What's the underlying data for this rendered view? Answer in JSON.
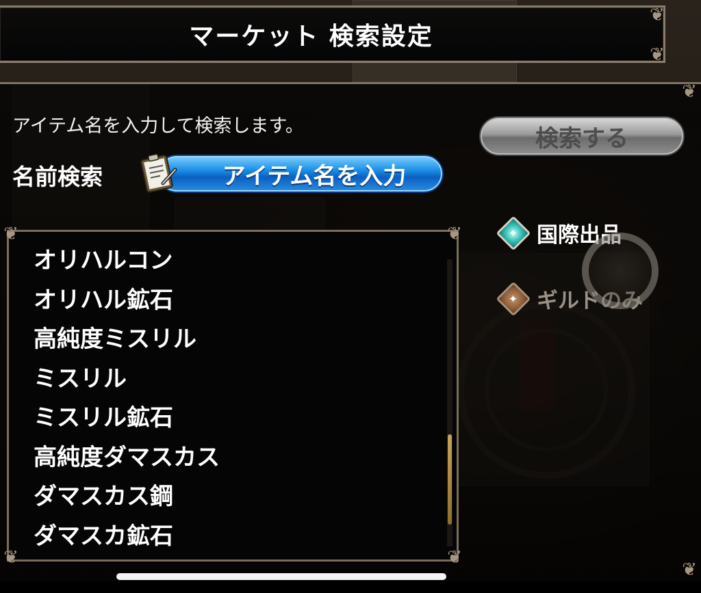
{
  "header": {
    "title": "マーケット 検索設定"
  },
  "search": {
    "instruction": "アイテム名を入力して検索します。",
    "button_label": "検索する",
    "name_label": "名前検索",
    "input_label": "アイテム名を入力"
  },
  "results": {
    "items": [
      "オリハルコン",
      "オリハル鉱石",
      "高純度ミスリル",
      "ミスリル",
      "ミスリル鉱石",
      "高純度ダマスカス",
      "ダマスカス鋼",
      "ダマスカ鉱石"
    ]
  },
  "filters": {
    "international": {
      "label": "国際出品",
      "selected": true
    },
    "guild_only": {
      "label": "ギルドのみ",
      "selected": false
    }
  },
  "icons": {
    "clipboard": "clipboard-icon",
    "diamond_active": "diamond-selected-icon",
    "diamond_inactive": "diamond-unselected-icon"
  },
  "colors": {
    "input_blue": "#1b8fe6",
    "button_gray": "#9a9a9a",
    "active_teal": "#2fb9b0",
    "inactive_bronze": "#8a5a36",
    "border_frame": "#7a6d5c"
  }
}
